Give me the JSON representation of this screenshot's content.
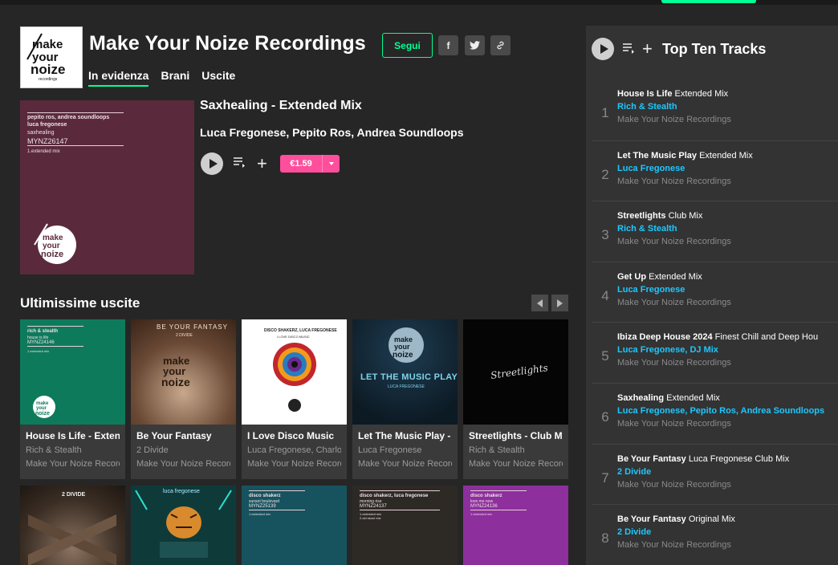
{
  "header": {
    "logo_text": "make your noize",
    "title": "Make Your Noize Recordings",
    "follow_label": "Segui",
    "share": {
      "facebook": "f",
      "twitter": "twitter-icon",
      "link": "link-icon"
    },
    "tabs": [
      {
        "label": "In evidenza",
        "active": true
      },
      {
        "label": "Brani",
        "active": false
      },
      {
        "label": "Uscite",
        "active": false
      }
    ]
  },
  "featured": {
    "art": {
      "artists_line": "pepito ros, andrea soundloops",
      "artist2_line": "luca fregonese",
      "title_line": "saxhealing",
      "catalog": "MYNZ26147",
      "mix_line": "1.extended mix",
      "logo_text": "make your noize"
    },
    "title": "Saxhealing - Extended Mix",
    "artists": "Luca Fregonese, Pepito Ros, Andrea Soundloops",
    "price": "€1.59"
  },
  "releases": {
    "title": "Ultimissime uscite",
    "cards": [
      {
        "title": "House Is Life - Exten",
        "artist": "Rich & Stealth",
        "label": "Make Your Noize Record",
        "art_color": "#0e7a5c",
        "art_lines": [
          "rich & stealth",
          "house is life",
          "MYNZ24146",
          "1.extended mix"
        ]
      },
      {
        "title": "Be Your Fantasy",
        "artist": "2 Divide",
        "label": "Make Your Noize Record",
        "art_color": "#8a6a55",
        "art_lines": [
          "BE YOUR FANTASY",
          "2 DIVIDE"
        ]
      },
      {
        "title": "I Love Disco Music",
        "artist": "Luca Fregonese, Charlot",
        "label": "Make Your Noize Record",
        "art_color": "#ffffff",
        "art_lines": [
          "DISCO SHAKERZ, LUCA FREGONESE",
          "I LOVE DISCO MUSIC"
        ]
      },
      {
        "title": "Let The Music Play -",
        "artist": "Luca Fregonese",
        "label": "Make Your Noize Record",
        "art_color": "#0f2230",
        "art_lines": [
          "LET THE MUSIC PLAY",
          "LUCA FREGONESE"
        ]
      },
      {
        "title": "Streetlights - Club M",
        "artist": "Rich & Stealth",
        "label": "Make Your Noize Record",
        "art_color": "#050505",
        "art_lines": [
          "Streetlights"
        ]
      }
    ],
    "row2": [
      {
        "art_color": "#4a3a2a",
        "art_lines": [
          "2 DIVIDE"
        ]
      },
      {
        "art_color": "#0f3a3a",
        "art_lines": [
          "luca fregonese"
        ]
      },
      {
        "art_color": "#16535e",
        "art_lines": [
          "disco shakerz",
          "sunset boulevard",
          "MYNZ25139",
          "1.extended mix"
        ]
      },
      {
        "art_color": "#2d2a26",
        "art_lines": [
          "disco shakerz, luca fregonese",
          "morning rise",
          "MYNZ24137",
          "1.extended mix",
          "2.old skool mix"
        ]
      },
      {
        "art_color": "#8d2f9c",
        "art_lines": [
          "disco shakerz",
          "love me now",
          "MYNZ24136",
          "1.extended mix"
        ]
      }
    ]
  },
  "top_ten": {
    "title": "Top Ten Tracks",
    "tracks": [
      {
        "num": "1",
        "name": "House Is Life",
        "mix": "Extended Mix",
        "artists": "Rich & Stealth",
        "label": "Make Your Noize Recordings"
      },
      {
        "num": "2",
        "name": "Let The Music Play",
        "mix": "Extended Mix",
        "artists": "Luca Fregonese",
        "label": "Make Your Noize Recordings"
      },
      {
        "num": "3",
        "name": "Streetlights",
        "mix": "Club Mix",
        "artists": "Rich & Stealth",
        "label": "Make Your Noize Recordings"
      },
      {
        "num": "4",
        "name": "Get Up",
        "mix": "Extended Mix",
        "artists": "Luca Fregonese",
        "label": "Make Your Noize Recordings"
      },
      {
        "num": "5",
        "name": "Ibiza Deep House 2024",
        "mix": "Finest Chill and Deep Hou",
        "artists": "Luca Fregonese, DJ Mix",
        "label": "Make Your Noize Recordings"
      },
      {
        "num": "6",
        "name": "Saxhealing",
        "mix": "Extended Mix",
        "artists": "Luca Fregonese, Pepito Ros, Andrea Soundloops",
        "label": "Make Your Noize Recordings"
      },
      {
        "num": "7",
        "name": "Be Your Fantasy",
        "mix": "Luca Fregonese Club Mix",
        "artists": "2 Divide",
        "label": "Make Your Noize Recordings"
      },
      {
        "num": "8",
        "name": "Be Your Fantasy",
        "mix": "Original Mix",
        "artists": "2 Divide",
        "label": "Make Your Noize Recordings"
      }
    ]
  },
  "colors": {
    "accent": "#01ff95",
    "price": "#ff4f9c",
    "link": "#1ec7ff"
  }
}
